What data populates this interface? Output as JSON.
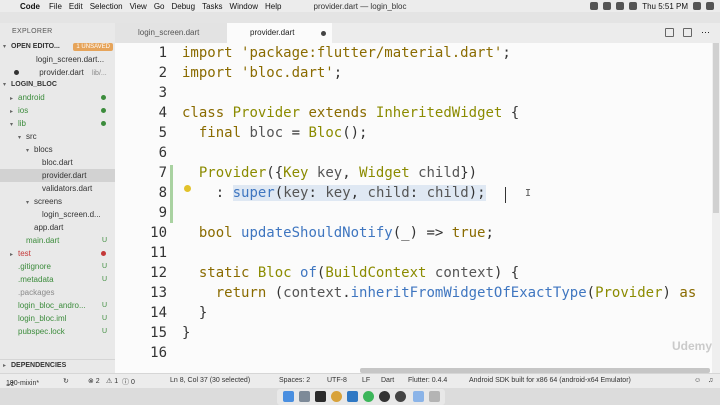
{
  "menubar": {
    "app": "Code",
    "items": [
      "File",
      "Edit",
      "Selection",
      "View",
      "Go",
      "Debug",
      "Tasks",
      "Window",
      "Help"
    ],
    "window_title": "provider.dart — login_bloc",
    "time": "Thu 5:51 PM"
  },
  "sidebar": {
    "title": "EXPLORER",
    "open_editors": {
      "label": "OPEN EDITO...",
      "badge": "1 UNSAVED",
      "files": [
        {
          "name": "login_screen.dart...",
          "path": ""
        },
        {
          "name": "provider.dart",
          "path": "lib/..."
        }
      ]
    },
    "project": {
      "label": "LOGIN_BLOC",
      "tree": [
        {
          "name": "android",
          "indent": 1,
          "arrow": "▸",
          "status": "dot-green"
        },
        {
          "name": "ios",
          "indent": 1,
          "arrow": "▸",
          "status": "dot-green"
        },
        {
          "name": "lib",
          "indent": 1,
          "arrow": "▾",
          "status": "dot-green"
        },
        {
          "name": "src",
          "indent": 2,
          "arrow": "▾",
          "status": ""
        },
        {
          "name": "blocs",
          "indent": 3,
          "arrow": "▾",
          "status": ""
        },
        {
          "name": "bloc.dart",
          "indent": 4,
          "arrow": "",
          "status": ""
        },
        {
          "name": "provider.dart",
          "indent": 4,
          "arrow": "",
          "status": "",
          "selected": true
        },
        {
          "name": "validators.dart",
          "indent": 4,
          "arrow": "",
          "status": ""
        },
        {
          "name": "screens",
          "indent": 3,
          "arrow": "▾",
          "status": ""
        },
        {
          "name": "login_screen.d...",
          "indent": 4,
          "arrow": "",
          "status": ""
        },
        {
          "name": "app.dart",
          "indent": 3,
          "arrow": "",
          "status": ""
        },
        {
          "name": "main.dart",
          "indent": 2,
          "arrow": "",
          "status": "U"
        },
        {
          "name": "test",
          "indent": 1,
          "arrow": "▸",
          "status": "dot-red",
          "red": true
        },
        {
          "name": ".gitignore",
          "indent": 1,
          "arrow": "",
          "status": "U"
        },
        {
          "name": ".metadata",
          "indent": 1,
          "arrow": "",
          "status": "U"
        },
        {
          "name": ".packages",
          "indent": 1,
          "arrow": "",
          "status": "",
          "muted": true
        },
        {
          "name": "login_bloc_andro...",
          "indent": 1,
          "arrow": "",
          "status": "U"
        },
        {
          "name": "login_bloc.iml",
          "indent": 1,
          "arrow": "",
          "status": "U"
        },
        {
          "name": "pubspec.lock",
          "indent": 1,
          "arrow": "",
          "status": "U"
        }
      ]
    },
    "dependencies_label": "DEPENDENCIES"
  },
  "tabs": [
    {
      "label": "login_screen.dart"
    },
    {
      "label": "provider.dart"
    }
  ],
  "editor": {
    "line_numbers": [
      "1",
      "2",
      "3",
      "4",
      "5",
      "6",
      "7",
      "8",
      "9",
      "10",
      "11",
      "12",
      "13",
      "14",
      "15",
      "16"
    ],
    "watermark": "Udemy"
  },
  "statusbar": {
    "branch": "190-mixin*",
    "errors": "⊗ 2",
    "warnings": "⚠ 1",
    "info": "ⓘ 0",
    "position": "Ln 8, Col 37 (30 selected)",
    "spaces": "Spaces: 2",
    "encoding": "UTF-8",
    "eol": "LF",
    "language": "Dart",
    "flutter": "Flutter: 0.4.4",
    "device": "Android SDK built for x86 64 (android-x64 Emulator)"
  },
  "colors": {
    "modified_bar": "#a9d2a1",
    "git_untracked": "#3c8c3c",
    "git_error": "#c43838",
    "badge": "#e6a45a"
  }
}
